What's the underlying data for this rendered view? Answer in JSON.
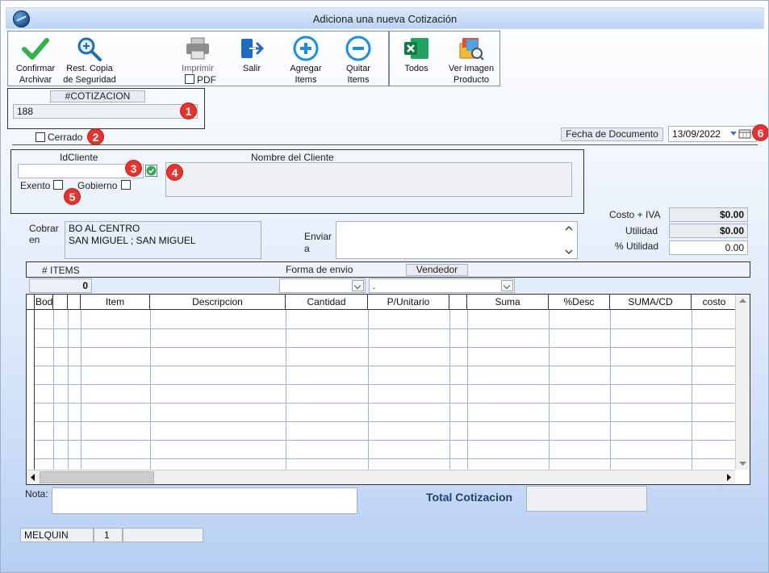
{
  "window": {
    "title": "Adiciona una nueva Cotización"
  },
  "toolbar": {
    "confirm": [
      "Confirmar",
      "Archivar"
    ],
    "restore": [
      "Rest. Copia",
      "de Seguridad"
    ],
    "print": "Imprimir",
    "pdf": "PDF",
    "exit": "Salir",
    "add": [
      "Agregar",
      "Items"
    ],
    "remove": [
      "Quitar",
      "Items"
    ],
    "all": "Todos",
    "view_image": [
      "Ver Imagen",
      "Producto"
    ]
  },
  "quote": {
    "label": "#COTIZACION",
    "value": "188"
  },
  "closed_label": "Cerrado",
  "doc_date": {
    "label": "Fecha de  Documento",
    "value": "13/09/2022"
  },
  "client": {
    "id_label": "IdCliente",
    "id_value": "",
    "name_label": "Nombre del Cliente",
    "name_value": "",
    "exento": "Exento",
    "gobierno": "Gobierno"
  },
  "billing": {
    "cobrar_label": [
      "Cobrar",
      "en"
    ],
    "cobrar_lines": [
      "BO AL CENTRO",
      "SAN MIGUEL ; SAN MIGUEL"
    ],
    "enviar_label": [
      "Enviar",
      "a"
    ],
    "enviar_value": ""
  },
  "totals": {
    "costo_iva_label": "Costo + IVA",
    "costo_iva": "$0.00",
    "utilidad_label": "Utilidad",
    "utilidad": "$0.00",
    "pct_utilidad_label": "% Utilidad",
    "pct_utilidad": "0.00"
  },
  "items_bar": {
    "items_label": "# ITEMS",
    "items_count": "0",
    "envio_label": "Forma de envio",
    "vendedor_label": "Vendedor",
    "vendedor_value": "."
  },
  "grid": {
    "columns": [
      "Bodega",
      "",
      "",
      "Item",
      "Descripcion",
      "Cantidad",
      "P/Unitario",
      "",
      "Suma",
      "%Desc",
      "SUMA/CD",
      "costo"
    ]
  },
  "footer": {
    "nota_label": "Nota:",
    "total_label": "Total Cotizacion",
    "total_value": "",
    "status": [
      "MELQUIN",
      "1",
      ""
    ]
  },
  "badges": [
    "1",
    "2",
    "3",
    "4",
    "5",
    "6"
  ],
  "colors": {
    "accent": "#1f4e8c",
    "badge": "#e8322f",
    "confirm": "#33b24a"
  }
}
